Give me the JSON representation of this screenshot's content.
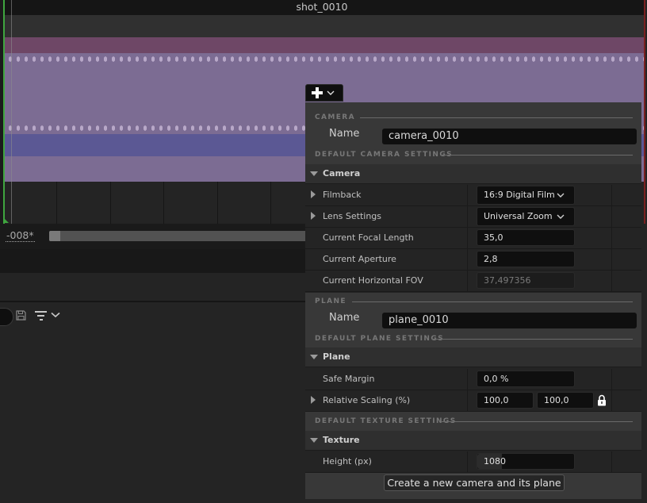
{
  "timeline": {
    "shot_title": "shot_0010",
    "frame_readout": "-008*",
    "track_colors": {
      "header": "#151515",
      "lane": "#303030",
      "magenta": "#6e4766",
      "purple": "#7c6c93",
      "blue": "#5b5894"
    },
    "playhead_color": "#3fa63f",
    "end_marker_color": "#7a2020"
  },
  "toolbar": {
    "save_icon": "save-icon",
    "filter_icon": "filter-icon",
    "filter_menu_icon": "chevron-down-icon"
  },
  "add_menu": {
    "icon": "plus-icon",
    "chevron": "chevron-down-icon"
  },
  "popup": {
    "camera_section": {
      "header": "CAMERA",
      "name_label": "Name",
      "name_value": "camera_0010"
    },
    "default_camera_settings": {
      "header": "DEFAULT CAMERA SETTINGS",
      "category": "Camera",
      "properties": [
        {
          "label": "Filmback",
          "value": "16:9 Digital Film",
          "type": "combo",
          "expandable": true
        },
        {
          "label": "Lens Settings",
          "value": "Universal Zoom",
          "type": "combo",
          "expandable": true
        },
        {
          "label": "Current Focal Length",
          "value": "35,0",
          "type": "number"
        },
        {
          "label": "Current Aperture",
          "value": "2,8",
          "type": "number"
        },
        {
          "label": "Current Horizontal FOV",
          "value": "37,497356",
          "type": "readonly"
        }
      ]
    },
    "plane_section": {
      "header": "PLANE",
      "name_label": "Name",
      "name_value": "plane_0010"
    },
    "default_plane_settings": {
      "header": "DEFAULT PLANE SETTINGS",
      "category": "Plane",
      "properties": [
        {
          "label": "Safe Margin",
          "value": "0,0 %",
          "type": "number"
        },
        {
          "label": "Relative Scaling (%)",
          "value_x": "100,0",
          "value_y": "100,0",
          "type": "vector2",
          "expandable": true,
          "locked": true
        }
      ]
    },
    "default_texture_settings": {
      "header": "DEFAULT TEXTURE SETTINGS",
      "category": "Texture",
      "properties": [
        {
          "label": "Height (px)",
          "value": "1080",
          "type": "number"
        }
      ]
    },
    "create_button": "Create a new camera and its plane"
  }
}
